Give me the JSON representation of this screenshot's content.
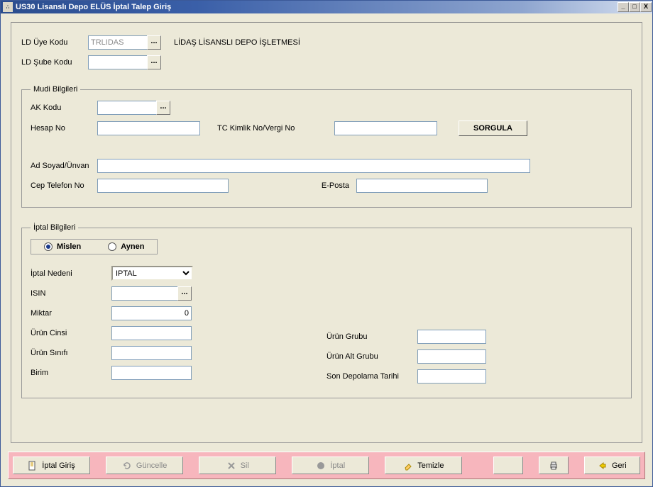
{
  "window": {
    "title": "US30 Lisanslı Depo ELÜS İptal Talep Giriş"
  },
  "top": {
    "ld_uye_kodu_label": "LD Üye Kodu",
    "ld_uye_kodu_value": "TRLIDAS",
    "company_name": "LİDAŞ LİSANSLI DEPO İŞLETMESİ",
    "ld_sube_kodu_label": "LD Şube Kodu",
    "ld_sube_kodu_value": ""
  },
  "mudi": {
    "legend": "Mudi Bilgileri",
    "ak_kodu_label": "AK Kodu",
    "ak_kodu_value": "",
    "hesap_no_label": "Hesap No",
    "hesap_no_value": "",
    "tckn_label": "TC Kimlik No/Vergi No",
    "tckn_value": "",
    "sorgula_label": "SORGULA",
    "adsoyad_label": "Ad Soyad/Ünvan",
    "adsoyad_value": "",
    "cep_label": "Cep Telefon No",
    "cep_value": "",
    "eposta_label": "E-Posta",
    "eposta_value": ""
  },
  "iptal": {
    "legend": "İptal Bilgileri",
    "radio_mislen": "Mislen",
    "radio_aynen": "Aynen",
    "neden_label": "İptal Nedeni",
    "neden_value": "IPTAL",
    "isin_label": "ISIN",
    "isin_value": "",
    "miktar_label": "Miktar",
    "miktar_value": "0",
    "urun_cinsi_label": "Ürün Cinsi",
    "urun_cinsi_value": "",
    "urun_sinifi_label": "Ürün Sınıfı",
    "urun_sinifi_value": "",
    "birim_label": "Birim",
    "birim_value": "",
    "urun_grubu_label": "Ürün Grubu",
    "urun_grubu_value": "",
    "urun_alt_grubu_label": "Ürün Alt Grubu",
    "urun_alt_grubu_value": "",
    "son_depolama_label": "Son Depolama Tarihi",
    "son_depolama_value": ""
  },
  "footer": {
    "iptal_giris": "İptal Giriş",
    "guncelle": "Güncelle",
    "sil": "Sil",
    "iptal": "İptal",
    "temizle": "Temizle",
    "geri": "Geri"
  }
}
